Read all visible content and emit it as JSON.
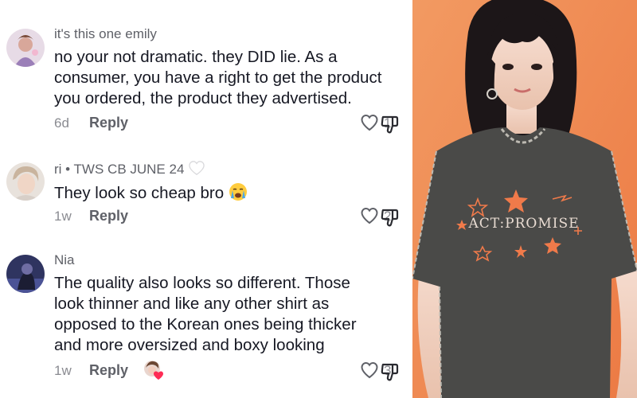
{
  "comments": [
    {
      "username": "it's this one emily",
      "text": "no your not dramatic. they DID lie. As a consumer, you have a right to get the product you ordered, the product they advertised.",
      "time": "6d",
      "reply_label": "Reply",
      "likes": "1"
    },
    {
      "username": "ri",
      "username_suffix": " • TWS CB JUNE 24",
      "text": "They look so cheap bro",
      "time": "1w",
      "reply_label": "Reply",
      "likes": "2"
    },
    {
      "username": "Nia",
      "text": "The quality also looks so different. Those look thinner and like any other shirt as opposed to the Korean ones being thicker and more oversized and boxy looking",
      "time": "1w",
      "reply_label": "Reply",
      "likes": "3"
    }
  ],
  "product": {
    "shirt_print": "ACT:PROMISE"
  },
  "colors": {
    "background_orange": "#f08a52",
    "shirt": "#4a4a48",
    "star_accent": "#f07a4a",
    "meta_gray": "#8a8b91"
  },
  "icons": [
    "heart-outline-icon",
    "dislike-icon",
    "white-heart-emoji",
    "crying-emoji",
    "creator-liked-avatar"
  ]
}
